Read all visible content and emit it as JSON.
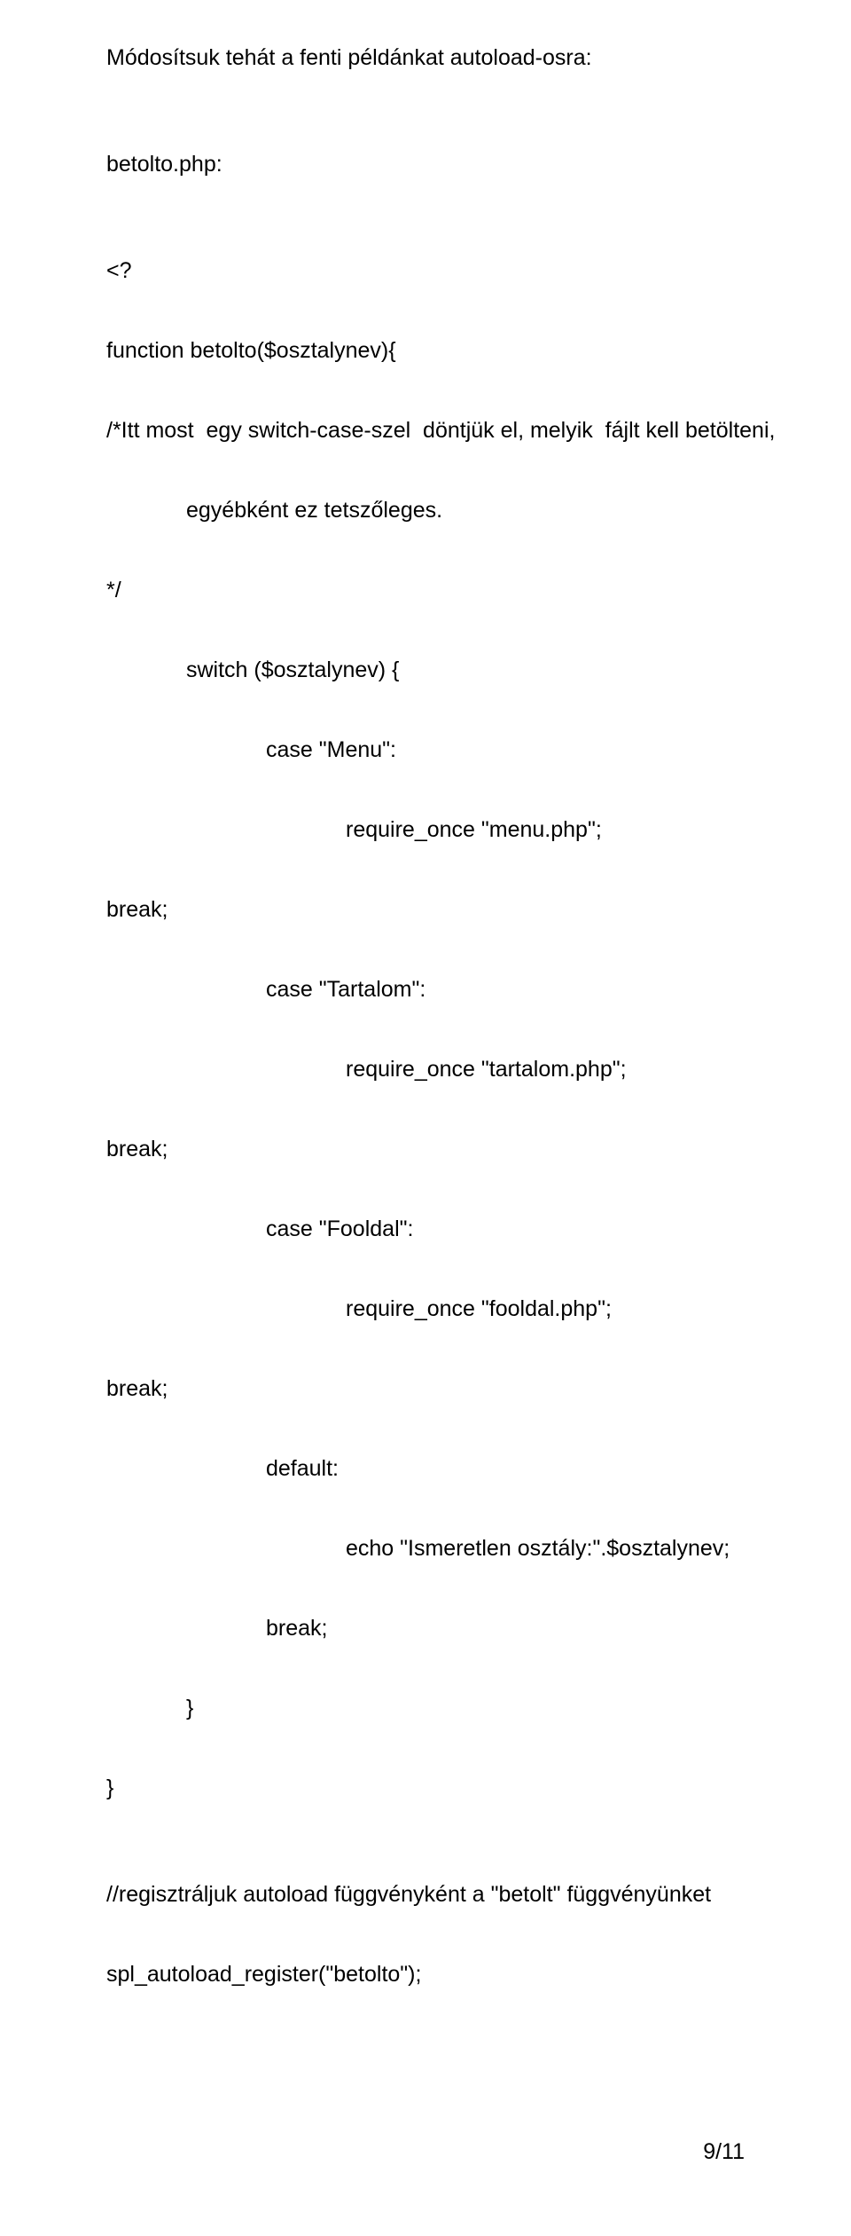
{
  "intro": "Módosítsuk tehát a fenti példánkat autoload-osra:",
  "code": {
    "l01": "betolto.php:",
    "l02": "<?",
    "l03": "function betolto($osztalynev){",
    "l04": "/*Itt most  egy switch-case-szel  döntjük el, melyik  fájlt kell betölteni,",
    "l05": "egyébként ez tetszőleges.",
    "l06": "*/",
    "l07": "switch ($osztalynev) {",
    "l08": "case \"Menu\":",
    "l09": "require_once \"menu.php\";",
    "l10": "break;",
    "l11": "case \"Tartalom\":",
    "l12": "require_once \"tartalom.php\";",
    "l13": "break;",
    "l14": "case \"Fooldal\":",
    "l15": "require_once \"fooldal.php\";",
    "l16": "break;",
    "l17": "default:",
    "l18": "echo \"Ismeretlen osztály:\".$osztalynev;",
    "l19": "break;",
    "l20": "}",
    "l21": "}",
    "l22": "//regisztráljuk autoload függvényként a \"betolt\" függvényünket",
    "l23": "spl_autoload_register(\"betolto\");"
  },
  "footer": "9/11"
}
